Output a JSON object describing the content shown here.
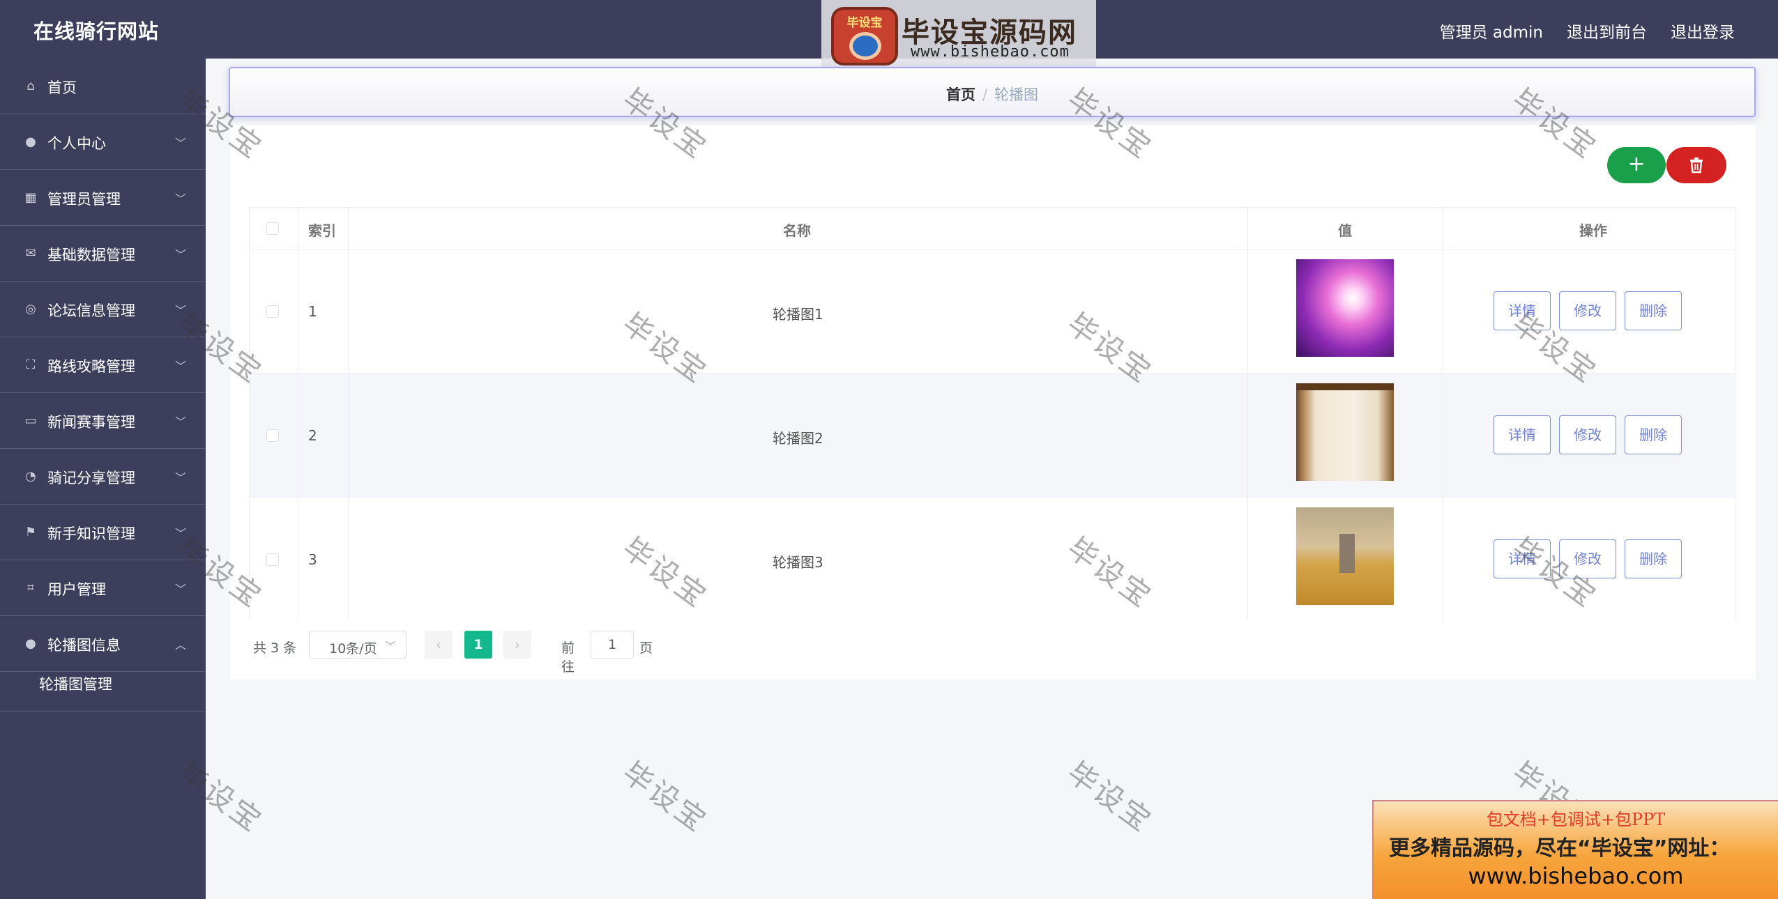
{
  "header": {
    "brand": "在线骑行网站",
    "admin_label": "管理员 admin",
    "front_link": "退出到前台",
    "logout_link": "退出登录"
  },
  "logo": {
    "badge": "毕设宝",
    "title": "毕设宝源码网",
    "url": "www.bishebao.com"
  },
  "sidebar": {
    "items": [
      {
        "label": "首页",
        "icon": "home-icon"
      },
      {
        "label": "个人中心",
        "icon": "user-icon"
      },
      {
        "label": "管理员管理",
        "icon": "grid-icon"
      },
      {
        "label": "基础数据管理",
        "icon": "mail-icon"
      },
      {
        "label": "论坛信息管理",
        "icon": "compass-icon"
      },
      {
        "label": "路线攻略管理",
        "icon": "fullscreen-icon"
      },
      {
        "label": "新闻赛事管理",
        "icon": "chat-icon"
      },
      {
        "label": "骑记分享管理",
        "icon": "gauge-icon"
      },
      {
        "label": "新手知识管理",
        "icon": "flag-icon"
      },
      {
        "label": "用户管理",
        "icon": "crop-icon"
      },
      {
        "label": "轮播图信息",
        "icon": "user-icon"
      }
    ],
    "subitem": "轮播图管理"
  },
  "breadcrumb": {
    "home": "首页",
    "separator": "/",
    "current": "轮播图"
  },
  "toolbar": {
    "add_symbol": "+",
    "delete_symbol": "🗑"
  },
  "table": {
    "headers": {
      "index": "索引",
      "name": "名称",
      "value": "值",
      "actions": "操作"
    },
    "rows": [
      {
        "index": "1",
        "name": "轮播图1",
        "thumb": "purple-light-burst"
      },
      {
        "index": "2",
        "name": "轮播图2",
        "thumb": "wooden-shutter-wall"
      },
      {
        "index": "3",
        "name": "轮播图3",
        "thumb": "hut-in-golden-field"
      }
    ],
    "actions": {
      "detail": "详情",
      "edit": "修改",
      "delete": "删除"
    }
  },
  "pagination": {
    "total": "共 3 条",
    "page_size": "10条/页",
    "current_page": "1",
    "goto_prefix": "前往",
    "goto_value": "1",
    "goto_suffix": "页",
    "prev": "‹",
    "next": "›"
  },
  "watermark": "毕设宝",
  "promo": {
    "line1": "包文档+包调试+包PPT",
    "line2": "更多精品源码，尽在“毕设宝”网址：",
    "line3": "www.bishebao.com"
  },
  "colors": {
    "sidebar_bg": "#3c3e5c",
    "accent": "#13b98c",
    "add_button": "#1aa04a",
    "delete_button": "#d42121"
  }
}
